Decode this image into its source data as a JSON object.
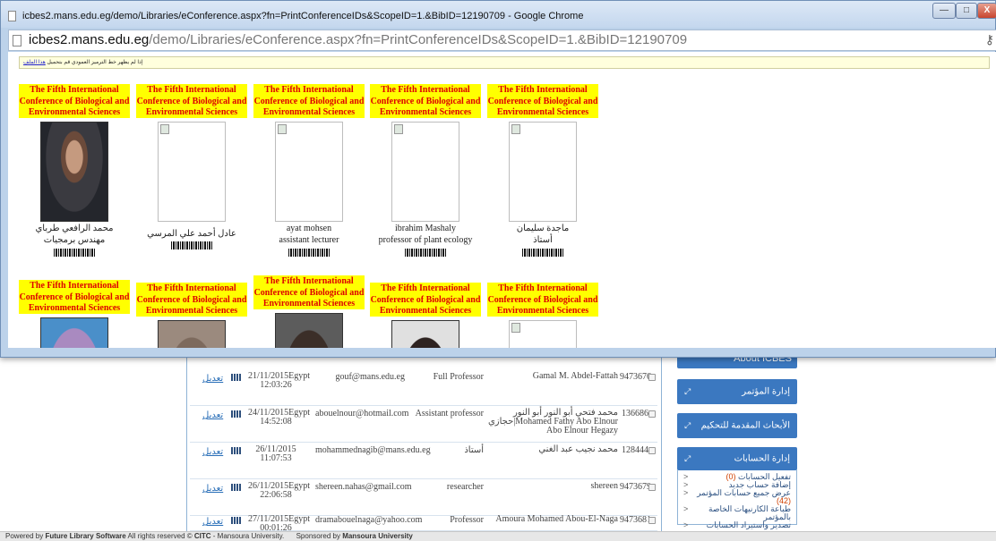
{
  "window": {
    "title": "icbes2.mans.edu.eg/demo/Libraries/eConference.aspx?fn=PrintConferenceIDs&ScopeID=1.&BibID=12190709 - Google Chrome",
    "url_host": "icbes2.mans.edu.eg",
    "url_path": "/demo/Libraries/eConference.aspx?fn=PrintConferenceIDs&ScopeID=1.&BibID=12190709",
    "minimize": "—",
    "maximize": "□",
    "close": "X"
  },
  "notice": {
    "text": "إذا لم يظهر خط الترميز العمودي قم بتحميل",
    "link": "هذا الملف"
  },
  "badge_banner": "The Fifth International Conference of Biological and Environmental Sciences",
  "cards_row1": [
    {
      "name": "محمد الرافعي طرباي",
      "title": "مهندس برمجيات",
      "photo": "dark"
    },
    {
      "name": "عادل أحمد علي المرسي",
      "title": "",
      "photo": "broken"
    },
    {
      "name": "ayat mohsen",
      "title": "assistant lecturer",
      "photo": "broken"
    },
    {
      "name": "ibrahim Mashaly",
      "title": "professor of plant ecology",
      "photo": "broken"
    },
    {
      "name": "ماجدة سليمان",
      "title": "أستاذ",
      "photo": "broken"
    }
  ],
  "cards_row2": [
    {
      "photo": "p-lilac"
    },
    {
      "photo": "p-bald"
    },
    {
      "photo": "p-glasses"
    },
    {
      "photo": "p-man"
    },
    {
      "photo": "broken"
    }
  ],
  "table_rows": [
    {
      "edit": "تعديل",
      "date": "21/11/2015Egypt 12:03:26",
      "email": "gouf@mans.edu.eg",
      "position": "Full Professor",
      "name": "Gamal M. Abdel-Fattah",
      "id": "9473676"
    },
    {
      "edit": "تعديل",
      "date": "24/11/2015Egypt 14:52:08",
      "email": "abouelnour@hotmail.com",
      "position": "Assistant professor",
      "name": "محمد فتحي أبو النور أبو النور حجازي|Mohamed Fathy Abo Elnour Abo Elnour Hegazy",
      "id": "136686"
    },
    {
      "edit": "تعديل",
      "date": "26/11/2015 11:07:53",
      "email": "mohammednagib@mans.edu.eg",
      "position": "أستاذ",
      "name": "محمد نجيب عبد الغني",
      "id": "128444"
    },
    {
      "edit": "تعديل",
      "date": "26/11/2015Egypt 22:06:58",
      "email": "shereen.nahas@gmail.com",
      "position": "researcher",
      "name": "shereen",
      "id": "9473679"
    },
    {
      "edit": "تعديل",
      "date": "27/11/2015Egypt 00:01:26",
      "email": "dramabouelnaga@yahoo.com",
      "position": "Professor",
      "name": "Amoura Mohamed Abou-El-Naga",
      "id": "9473681"
    }
  ],
  "sidebar": {
    "about": "About ICBES",
    "conf_admin": "إدارة المؤتمر",
    "research": "الأبحاث المقدمة للتحكيم",
    "accounts": "إدارة الحسابات",
    "account_links": [
      {
        "label": "تفعيل الحسابات",
        "count": "(0)"
      },
      {
        "label": "إضافة حساب جديد",
        "count": ""
      },
      {
        "label": "عرض جميع حسابات المؤتمر",
        "count": "(42)"
      },
      {
        "label": "طباعة الكارنيهات الخاصة بالمؤتمر",
        "count": ""
      },
      {
        "label": "تصدير واستيراد الحسابات",
        "count": ""
      }
    ]
  },
  "status": {
    "powered": "Powered by",
    "fls": "Future Library Software",
    "rights": "All rights reserved ©",
    "citc": "CITC",
    "mans": "- Mansoura University.",
    "sponsored": "Sponsored by",
    "sponsor": "Mansoura University"
  }
}
